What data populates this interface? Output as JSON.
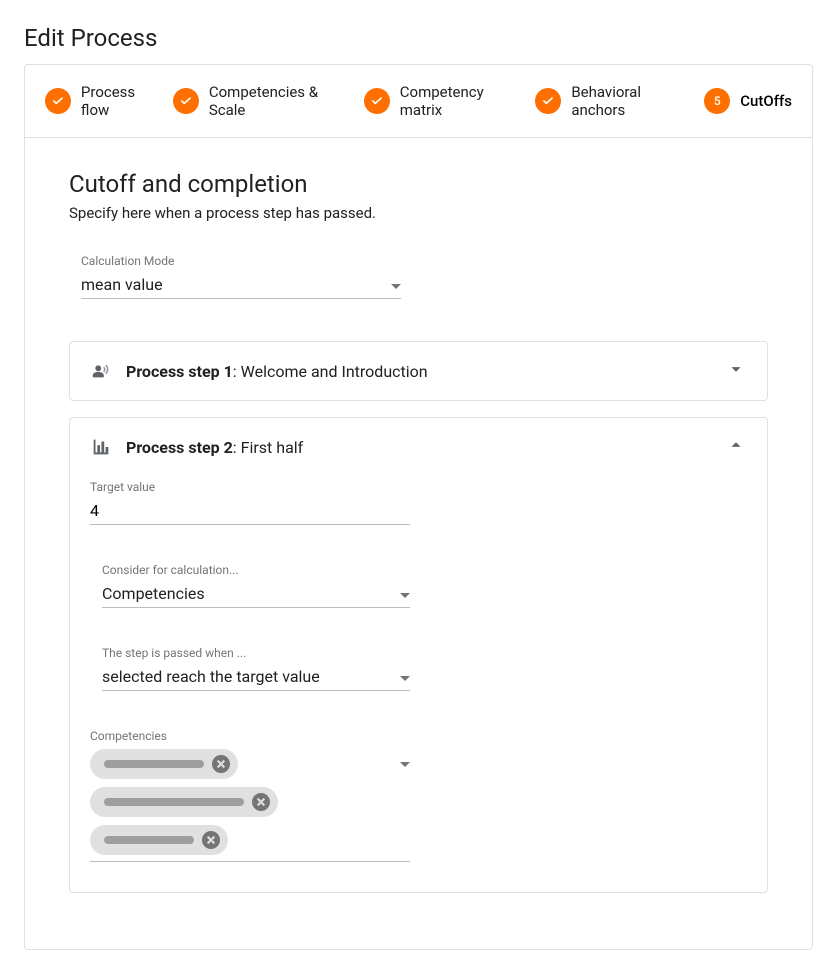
{
  "page": {
    "title": "Edit Process"
  },
  "stepper": {
    "steps": [
      {
        "label": "Process flow",
        "state": "done"
      },
      {
        "label": "Competencies & Scale",
        "state": "done"
      },
      {
        "label": "Competency matrix",
        "state": "done"
      },
      {
        "label": "Behavioral anchors",
        "state": "done"
      },
      {
        "label": "CutOffs",
        "state": "active",
        "number": "5"
      }
    ]
  },
  "section": {
    "title": "Cutoff and completion",
    "subtitle": "Specify here when a process step has passed."
  },
  "fields": {
    "calc_mode_label": "Calculation Mode",
    "calc_mode_value": "mean value"
  },
  "panels": {
    "step1": {
      "prefix": "Process step 1",
      "suffix": ": Welcome and Introduction"
    },
    "step2": {
      "prefix": "Process step 2",
      "suffix": ": First half",
      "target_value_label": "Target value",
      "target_value": "4",
      "consider_label": "Consider for calculation...",
      "consider_value": "Competencies",
      "passed_label": "The step is passed when ...",
      "passed_value": "selected reach the target value",
      "competencies_label": "Competencies",
      "chip_widths": [
        100,
        140,
        90
      ]
    }
  }
}
